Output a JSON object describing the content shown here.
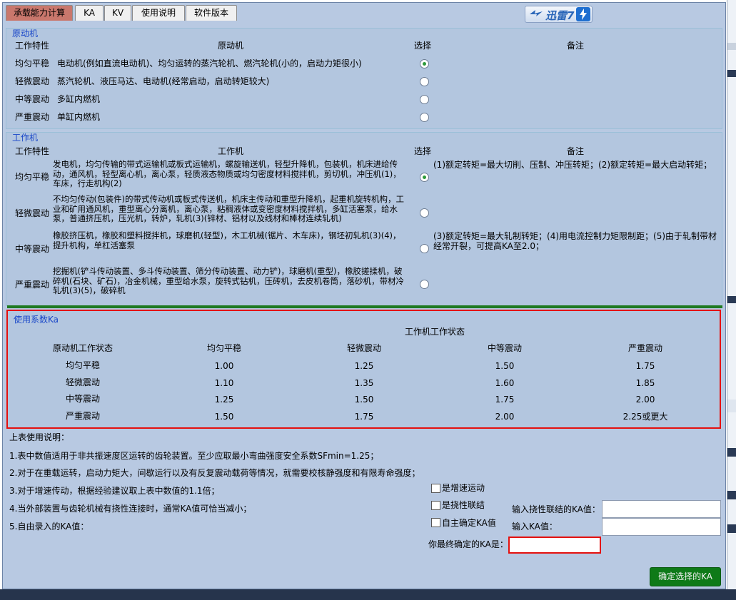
{
  "tabs": [
    {
      "label": "承载能力计算"
    },
    {
      "label": "KA"
    },
    {
      "label": "KV"
    },
    {
      "label": "使用说明"
    },
    {
      "label": "软件版本"
    }
  ],
  "logo": {
    "text": "迅雷7"
  },
  "prime": {
    "title": "原动机",
    "headers": {
      "characteristic": "工作特性",
      "machine": "原动机",
      "select": "选择",
      "remark": "备注"
    },
    "rows": [
      {
        "characteristic": "均匀平稳",
        "desc": "电动机(例如直流电动机)、均匀运转的蒸汽轮机、燃汽轮机(小的，启动力矩很小)",
        "checked": true
      },
      {
        "characteristic": "轻微震动",
        "desc": "蒸汽轮机、液压马达、电动机(经常启动，启动转矩较大)",
        "checked": false
      },
      {
        "characteristic": "中等震动",
        "desc": "多缸内燃机",
        "checked": false
      },
      {
        "characteristic": "严重震动",
        "desc": "单缸内燃机",
        "checked": false
      }
    ]
  },
  "work": {
    "title": "工作机",
    "headers": {
      "characteristic": "工作特性",
      "machine": "工作机",
      "select": "选择",
      "remark": "备注"
    },
    "rows": [
      {
        "characteristic": "均匀平稳",
        "desc": "发电机，均匀传输的带式运输机或板式运输机，螺旋输送机，轻型升降机，包装机，机床进给传动，通风机，轻型离心机，离心泵，轻质液态物质或均匀密度材料搅拌机，剪切机，冲压机(1)，车床，行走机构(2)",
        "checked": true
      },
      {
        "characteristic": "轻微震动",
        "desc": "不均匀传动(包装件)的带式传动机或板式传送机，机床主传动和重型升降机，起重机旋转机构，工业和矿用通风机，重型离心分离机，离心泵，粘稠液体或变密度材料搅拌机，多缸活塞泵，给水泵，普通挤压机，压光机，转炉，轧机(3)(锌材、铝材以及线材和棒材连续轧机)",
        "checked": false
      },
      {
        "characteristic": "中等震动",
        "desc": "橡胶挤压机，橡胶和塑料搅拌机，球磨机(轻型)，木工机械(锯片、木车床)，钢坯初轧机(3)(4)，提升机构，单杠活塞泵",
        "checked": false
      },
      {
        "characteristic": "严重震动",
        "desc": "挖掘机(铲斗传动装置、多斗传动装置、筛分传动装置、动力铲)，球磨机(重型)，橡胶搓揉机，破碎机(石块、矿石)，冶金机械，重型给水泵，旋转式钻机，压砖机，去皮机卷筒，落砂机，带材冷轧机(3)(5)，破碎机",
        "checked": false
      }
    ],
    "remarks": [
      "(1)额定转矩=最大切削、压制、冲压转矩；(2)额定转矩=最大启动转矩；",
      "(3)额定转矩=最大轧制转矩；(4)用电流控制力矩限制距；(5)由于轧制带材经常开裂，可提高KA至2.0；"
    ]
  },
  "ka": {
    "title": "使用系数Ka",
    "group_header": "工作机工作状态",
    "row_header": "原动机工作状态",
    "columns": [
      "均匀平稳",
      "轻微震动",
      "中等震动",
      "严重震动"
    ],
    "rows": [
      {
        "label": "均匀平稳",
        "values": [
          "1.00",
          "1.25",
          "1.50",
          "1.75"
        ]
      },
      {
        "label": "轻微震动",
        "values": [
          "1.10",
          "1.35",
          "1.60",
          "1.85"
        ]
      },
      {
        "label": "中等震动",
        "values": [
          "1.25",
          "1.50",
          "1.75",
          "2.00"
        ]
      },
      {
        "label": "严重震动",
        "values": [
          "1.50",
          "1.75",
          "2.00",
          "2.25或更大"
        ]
      }
    ]
  },
  "notes": {
    "title": "上表使用说明：",
    "items": [
      "1.表中数值适用于非共振速度区运转的齿轮装置。至少应取最小弯曲强度安全系数SFmin=1.25；",
      "2.对于在重载运转，启动力矩大，间歇运行以及有反复震动载荷等情况，就需要校核静强度和有限寿命强度；",
      "3.对于增速传动，根据经验建议取上表中数值的1.1倍；",
      "4.当外部装置与齿轮机械有挠性连接时，通常KA值可恰当减小；",
      "5.自由录入的KA值："
    ]
  },
  "options": {
    "speedup_label": "是增速运动",
    "flexible_label": "是挠性联结",
    "self_label": "自主确定KA值",
    "flex_input_label": "输入挠性联结的KA值：",
    "flex_input_value": "",
    "ka_input_label": "输入KA值：",
    "ka_input_value": "",
    "final_label": "你最终确定的KA是：",
    "final_value": ""
  },
  "confirm_button": "确定选择的KA"
}
